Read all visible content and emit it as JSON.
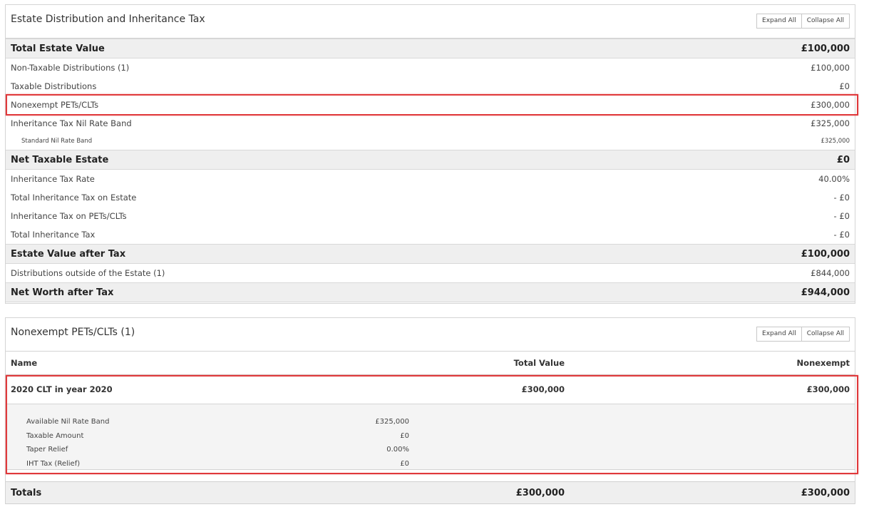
{
  "summary": {
    "title": "Estate Distribution and Inheritance Tax",
    "expand_label": "Expand All",
    "collapse_label": "Collapse All",
    "rows": [
      {
        "label": "Total Estate Value",
        "value": "£100,000"
      },
      {
        "label": "Non-Taxable Distributions (1)",
        "value": "£100,000"
      },
      {
        "label": "Taxable Distributions",
        "value": "£0"
      },
      {
        "label": "Nonexempt PETs/CLTs",
        "value": "£300,000"
      },
      {
        "label": "Inheritance Tax Nil Rate Band",
        "value": "£325,000"
      },
      {
        "label": "Standard Nil Rate Band",
        "value": "£325,000"
      },
      {
        "label": "Net Taxable Estate",
        "value": "£0"
      },
      {
        "label": "Inheritance Tax Rate",
        "value": "40.00%"
      },
      {
        "label": "Total Inheritance Tax on Estate",
        "value": "- £0"
      },
      {
        "label": "Inheritance Tax on PETs/CLTs",
        "value": "- £0"
      },
      {
        "label": "Total Inheritance Tax",
        "value": "- £0"
      },
      {
        "label": "Estate Value after Tax",
        "value": "£100,000"
      },
      {
        "label": "Distributions outside of the Estate (1)",
        "value": "£844,000"
      },
      {
        "label": "Net Worth after Tax",
        "value": "£944,000"
      }
    ]
  },
  "pets": {
    "title": "Nonexempt PETs/CLTs (1)",
    "expand_label": "Expand All",
    "collapse_label": "Collapse All",
    "columns": {
      "name": "Name",
      "total": "Total Value",
      "nonexempt": "Nonexempt"
    },
    "item": {
      "name": "2020 CLT in year 2020",
      "total": "£300,000",
      "nonexempt": "£300,000",
      "details": [
        {
          "label": "Available Nil Rate Band",
          "value": "£325,000"
        },
        {
          "label": "Taxable Amount",
          "value": "£0"
        },
        {
          "label": "Taper Relief",
          "value": "0.00%"
        },
        {
          "label": "IHT Tax (Relief)",
          "value": "£0"
        }
      ]
    },
    "totals": {
      "label": "Totals",
      "total": "£300,000",
      "nonexempt": "£300,000"
    }
  },
  "colors": {
    "highlight": "#e0393b",
    "section_bg": "#efefef",
    "detail_bg": "#f4f4f4"
  }
}
